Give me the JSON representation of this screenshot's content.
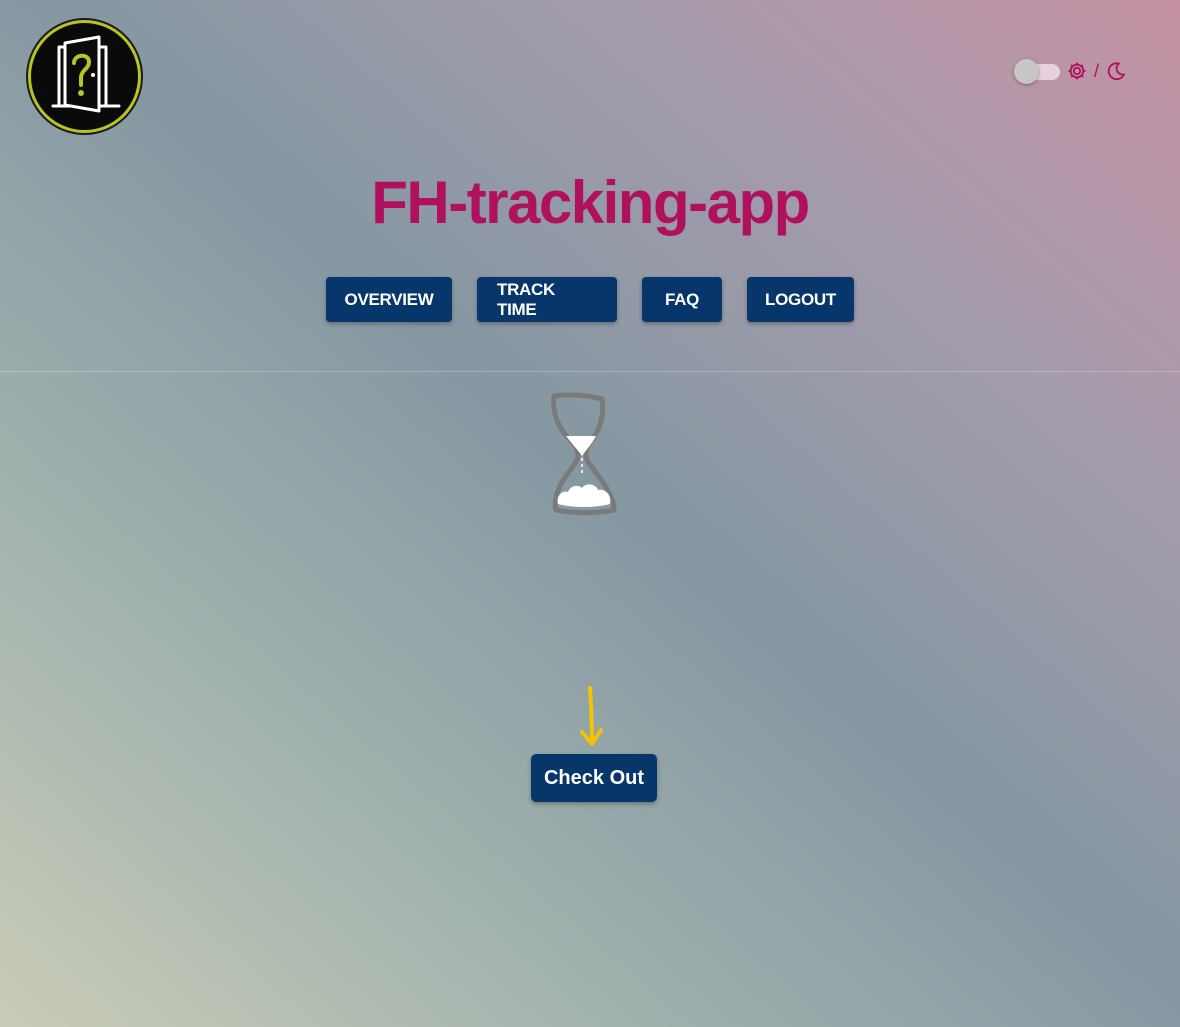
{
  "app": {
    "title": "FH-tracking-app",
    "logo_icon": "door-question-icon"
  },
  "theme_toggle": {
    "state": "light",
    "separator": "/",
    "light_icon": "gear-sun-icon",
    "dark_icon": "moon-icon",
    "accent_color": "#b0115f"
  },
  "nav": {
    "items": [
      {
        "label": "OVERVIEW"
      },
      {
        "label": "TRACK TIME"
      },
      {
        "label": "FAQ"
      },
      {
        "label": "LOGOUT"
      }
    ],
    "button_color": "#07366a"
  },
  "main": {
    "status_icon": "hourglass-icon",
    "pointer_icon": "arrow-down-icon",
    "checkout_label": "Check Out",
    "pointer_color": "#f5c400"
  }
}
